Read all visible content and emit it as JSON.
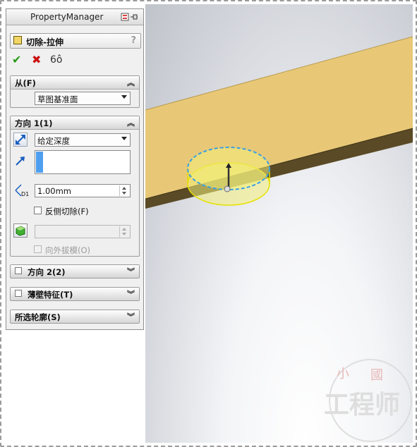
{
  "panel": {
    "title": "PropertyManager",
    "feature_title": "切除-拉伸",
    "help": "?",
    "confirm": "✔",
    "cancel": "✖",
    "preview": "6ô"
  },
  "from_group": {
    "title": "从(F)",
    "start_condition": "草图基准面"
  },
  "direction1": {
    "title": "方向 1(1)",
    "end_condition": "给定深度",
    "depth": "1.00mm",
    "flip_side_label": "反侧切除(F)",
    "draft_outward_label": "向外拔模(O)"
  },
  "collapsed_groups": {
    "direction2": "方向 2(2)",
    "thin_feature": "薄壁特征(T)",
    "selected_contours": "所选轮廓(S)"
  },
  "watermark": {
    "text_top_left": "小",
    "text_top_right": "國",
    "text_main": "工程师"
  },
  "colors": {
    "part_face": "#e8c877",
    "preview_circle": "#f2ee7a",
    "sketch_dash": "#3aa0e0",
    "accent_blue": "#4f9ff0"
  }
}
